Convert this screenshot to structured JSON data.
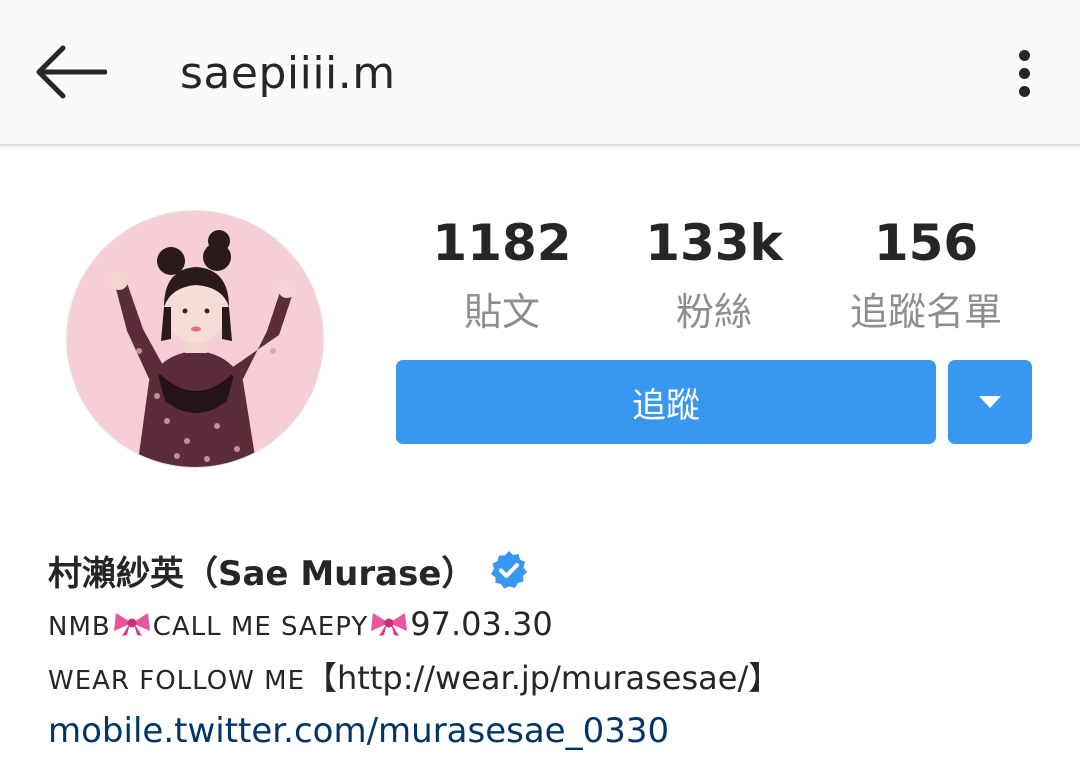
{
  "header": {
    "username": "saepiiii.m",
    "back_icon": "arrow-left-icon",
    "more_icon": "more-vertical-icon"
  },
  "profile": {
    "avatar_icon": "profile-photo"
  },
  "stats": [
    {
      "value": "1182",
      "label": "貼文"
    },
    {
      "value": "133k",
      "label": "粉絲"
    },
    {
      "value": "156",
      "label": "追蹤名單"
    }
  ],
  "actions": {
    "follow_label": "追蹤",
    "dropdown_icon": "triangle-down-icon",
    "accent_color": "#3897f0"
  },
  "bio": {
    "name": "村瀨紗英（Sae Murase）",
    "verified_icon": "verified-badge-icon",
    "line1_a": "NMB",
    "line1_b": "CALL ME SAEPY",
    "line1_c": "97.03.30",
    "line2_a": "WEAR FOLLOW ME",
    "line2_b": "【http://wear.jp/murasesae/】",
    "link": "mobile.twitter.com/murasesae_0330",
    "bow_icon": "ribbon-emoji-icon"
  }
}
